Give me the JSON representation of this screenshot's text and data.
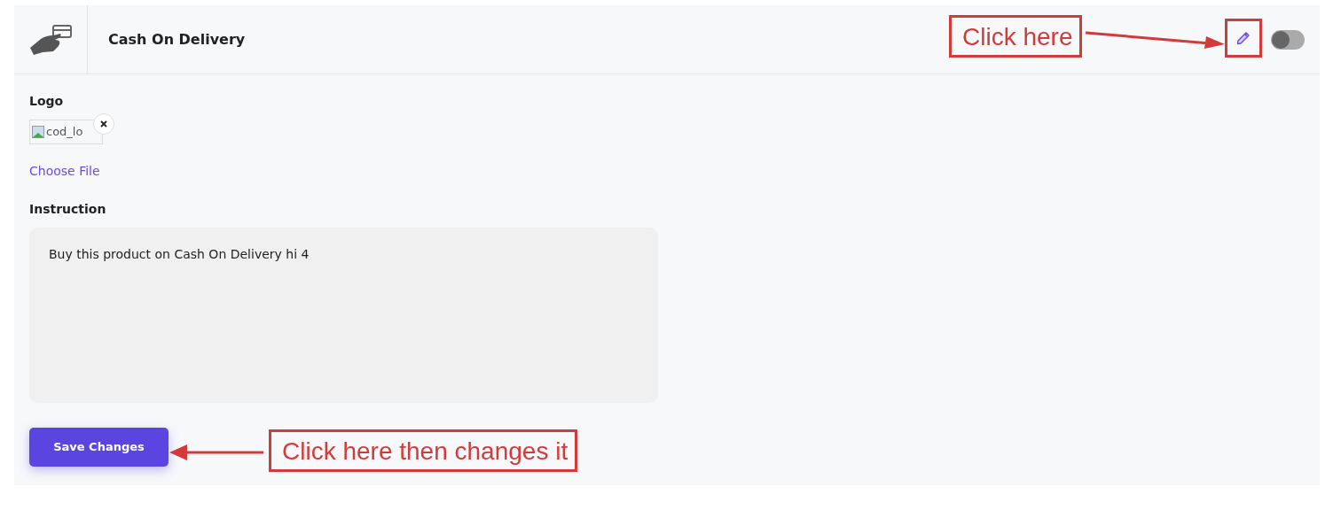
{
  "header": {
    "title": "Cash On Delivery",
    "toggle": {
      "on": false
    }
  },
  "logo": {
    "label": "Logo",
    "alt_text": "cod_lo",
    "choose_file": "Choose File"
  },
  "instruction": {
    "label": "Instruction",
    "value": "Buy this product on Cash On Delivery hi 4"
  },
  "save_button": "Save Changes",
  "annotations": [
    {
      "text": "Click here",
      "kind": "rightward"
    },
    {
      "text": "Click here then changes it",
      "kind": "leftward"
    }
  ]
}
